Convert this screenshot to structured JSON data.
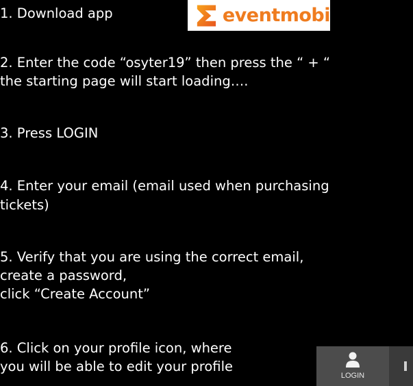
{
  "colors": {
    "background": "#000000",
    "text": "#ffffff",
    "logo_accent": "#ef7c1f"
  },
  "steps": [
    {
      "id": 1,
      "lines": [
        "1.   Download app"
      ]
    },
    {
      "id": 2,
      "lines": [
        "2. Enter the code “osyter19” then press the “ + “",
        "      the starting page will start loading…."
      ]
    },
    {
      "id": 3,
      "lines": [
        "3. Press LOGIN"
      ]
    },
    {
      "id": 4,
      "lines": [
        "4. Enter your email (email used when  purchasing",
        "tickets)"
      ]
    },
    {
      "id": 5,
      "lines": [
        "5. Verify that you are using the correct email,",
        "   create  a password,",
        "  click  “Create Account”"
      ]
    },
    {
      "id": 6,
      "lines": [
        "6. Click on your profile icon, where",
        "  you will be able to edit your profile"
      ]
    }
  ],
  "logo": {
    "text": "eventmobi",
    "icon": "eventmobi-sigma-icon"
  },
  "login_widget": {
    "label": "LOGIN",
    "icon": "user-icon"
  }
}
